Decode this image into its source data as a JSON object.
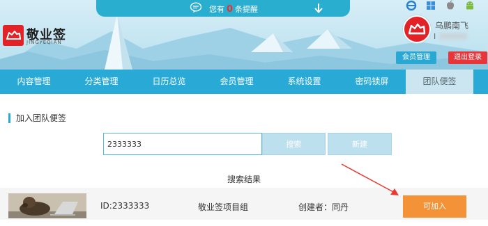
{
  "notice": {
    "prefix": "您有",
    "count": "0",
    "suffix": "条提醒"
  },
  "platform_icons": [
    "ie-icon",
    "windows-icon",
    "apple-icon",
    "android-icon"
  ],
  "logo": {
    "title": "敬业签",
    "subtitle": "JINGYEQIAN"
  },
  "user": {
    "name": "乌鹏南飞",
    "id_prefix": "I"
  },
  "buttons": {
    "member": "会员管理",
    "logout": "退出登录"
  },
  "nav": {
    "items": [
      "内容管理",
      "分类管理",
      "日历总览",
      "会员管理",
      "系统设置",
      "密码锁屏",
      "团队便签"
    ],
    "active": "团队便签"
  },
  "section_title": "加入团队便签",
  "search": {
    "value": "2333333",
    "search_label": "搜索",
    "new_label": "新建"
  },
  "results": {
    "title": "搜索结果",
    "row": {
      "id": "ID:2333333",
      "group": "敬业签项目组",
      "creator": "创建者：同丹",
      "join_label": "可加入"
    }
  },
  "colors": {
    "primary": "#29a9d5",
    "accent_red": "#e32228",
    "join_orange": "#f39237"
  }
}
